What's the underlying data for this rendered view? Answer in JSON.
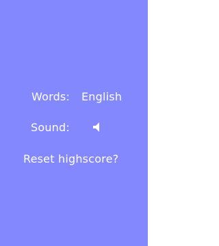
{
  "colors": {
    "background": "#8488ff",
    "text": "#ffffff"
  },
  "settings": {
    "words_label": "Words:",
    "words_value": "English",
    "sound_label": "Sound:",
    "sound_icon": "speaker-icon",
    "reset_label": "Reset highscore?"
  }
}
